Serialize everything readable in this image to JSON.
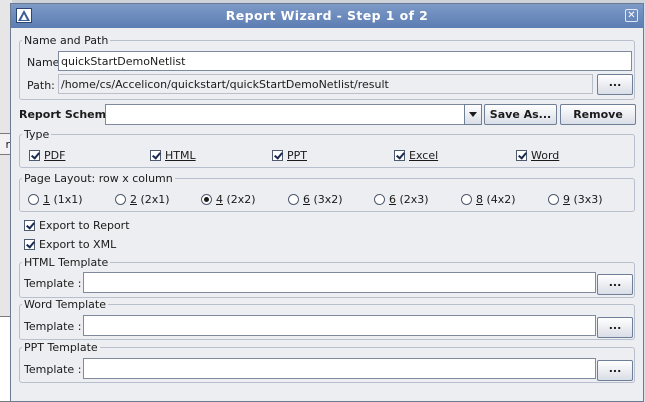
{
  "dialog": {
    "title": "Report Wizard  -  Step 1 of 2",
    "close_glyph": "✕"
  },
  "background": {
    "tab_label": "r"
  },
  "name_and_path": {
    "legend": "Name and Path",
    "name_label": "Name:",
    "name_value": "quickStartDemoNetlist",
    "path_label": "Path:",
    "path_value": "/home/cs/Accelicon/quickstart/quickStartDemoNetlist/result",
    "browse_label": "..."
  },
  "report_scheme": {
    "label": "Report Scheme :",
    "value": "",
    "save_as_label": "Save As...",
    "remove_label": "Remove"
  },
  "type": {
    "legend": "Type",
    "items": [
      {
        "label": "PDF",
        "checked": true
      },
      {
        "label": "HTML",
        "checked": true
      },
      {
        "label": "PPT",
        "checked": true
      },
      {
        "label": "Excel",
        "checked": true
      },
      {
        "label": "Word",
        "checked": true
      }
    ]
  },
  "page_layout": {
    "legend": "Page Layout: row x column",
    "options": [
      {
        "num": "1",
        "dims": "(1x1)",
        "selected": false
      },
      {
        "num": "2",
        "dims": "(2x1)",
        "selected": false
      },
      {
        "num": "4",
        "dims": "(2x2)",
        "selected": true
      },
      {
        "num": "6",
        "dims": "(3x2)",
        "selected": false
      },
      {
        "num": "6",
        "dims": "(2x3)",
        "selected": false
      },
      {
        "num": "8",
        "dims": "(4x2)",
        "selected": false
      },
      {
        "num": "9",
        "dims": "(3x3)",
        "selected": false
      }
    ]
  },
  "export": {
    "to_report_label": "Export to Report",
    "to_report_checked": true,
    "to_xml_label": "Export to XML",
    "to_xml_checked": true
  },
  "html_template": {
    "legend": "HTML Template",
    "label": "Template :",
    "value": "",
    "browse_label": "..."
  },
  "word_template": {
    "legend": "Word Template",
    "label": "Template :",
    "value": "",
    "browse_label": "..."
  },
  "ppt_template": {
    "legend": "PPT Template",
    "label": "Template :",
    "value": "",
    "browse_label": "..."
  },
  "colors": {
    "titlebar": "#6a89bd",
    "window_bg": "#edeef2",
    "border": "#b8c0ce"
  }
}
